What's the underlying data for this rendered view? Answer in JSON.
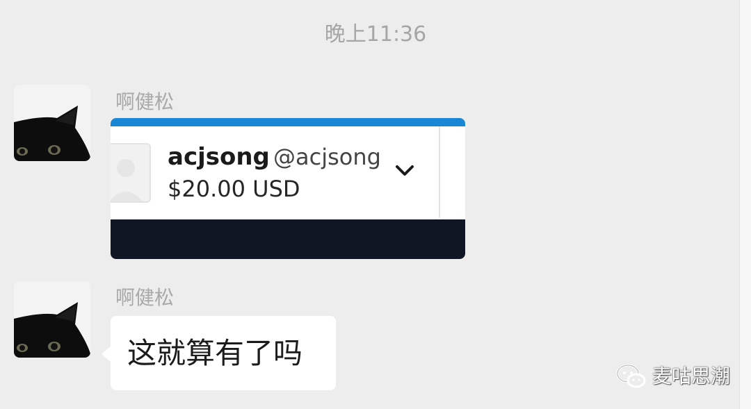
{
  "chat": {
    "timestamp": "晚上11:36",
    "messages": [
      {
        "sender": "啊健松",
        "type": "payment-card",
        "card": {
          "name": "acjsong",
          "handle": "@acjsong",
          "amount": "$20.00 USD"
        }
      },
      {
        "sender": "啊健松",
        "type": "text",
        "text": "这就算有了吗"
      }
    ]
  },
  "watermark": {
    "text": "麦咕思潮",
    "icon": "wechat-icon"
  },
  "colors": {
    "background": "#ededed",
    "card_accent": "#1a86d6",
    "card_footer": "#111624",
    "bubble": "#ffffff"
  }
}
